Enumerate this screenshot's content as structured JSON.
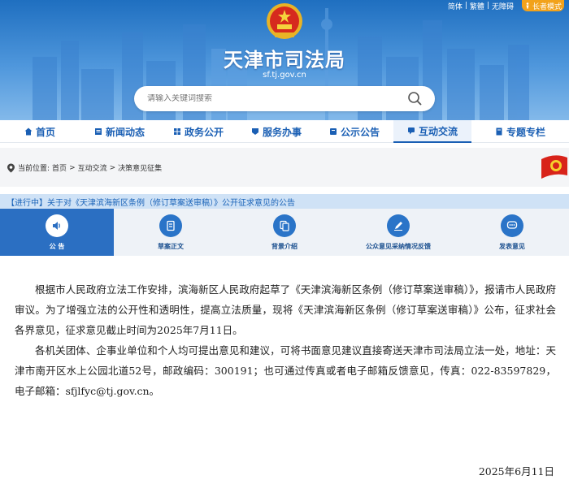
{
  "header": {
    "util_links": [
      "简体",
      "|",
      "繁體",
      "|",
      "无障碍"
    ],
    "elder_mode": "长者模式",
    "site_title": "天津市司法局",
    "site_domain": "sf.tj.gov.cn",
    "search_placeholder": "请输入关键词搜索"
  },
  "nav": {
    "items": [
      {
        "label": "首页",
        "icon": "home-icon"
      },
      {
        "label": "新闻动态",
        "icon": "news-icon"
      },
      {
        "label": "政务公开",
        "icon": "gov-icon"
      },
      {
        "label": "服务办事",
        "icon": "service-icon"
      },
      {
        "label": "公示公告",
        "icon": "notice-icon"
      },
      {
        "label": "互动交流",
        "icon": "interact-icon",
        "active": true
      },
      {
        "label": "专题专栏",
        "icon": "topic-icon"
      }
    ]
  },
  "breadcrumb": {
    "prefix": "当前位置:",
    "items": [
      "首页",
      "互动交流",
      "决策意见征集"
    ],
    "separator": ">"
  },
  "notice": {
    "title": "【进行中】关于对《天津滨海新区条例（修订草案送审稿）》公开征求意见的公告"
  },
  "tabs": [
    {
      "label": "公  告",
      "icon": "speaker-icon",
      "active": true
    },
    {
      "label": "草案正文",
      "icon": "document-icon"
    },
    {
      "label": "背景介绍",
      "icon": "files-icon"
    },
    {
      "label": "公众意见采纳情况反馈",
      "icon": "pen-icon"
    },
    {
      "label": "发表意见",
      "icon": "chat-icon"
    }
  ],
  "article": {
    "paragraphs": [
      "根据市人民政府立法工作安排，滨海新区人民政府起草了《天津滨海新区条例（修订草案送审稿）》，报请市人民政府审议。为了增强立法的公开性和透明性，提高立法质量，现将《天津滨海新区条例（修订草案送审稿）》公布，征求社会各界意见，征求意见截止时间为2025年7月11日。",
      "各机关团体、企事业单位和个人均可提出意见和建议，可将书面意见建议直接寄送天津市司法局立法一处，地址：天津市南开区水上公园北道52号，邮政编码：300191；也可通过传真或者电子邮箱反馈意见，传真：022-83597829，电子邮箱：sfjlfyc@tj.gov.cn。"
    ],
    "date": "2025年6月11日"
  },
  "colors": {
    "brand_blue": "#1a5fb4",
    "tab_active": "#2b6fc2",
    "elder_orange": "#f2a21b"
  }
}
